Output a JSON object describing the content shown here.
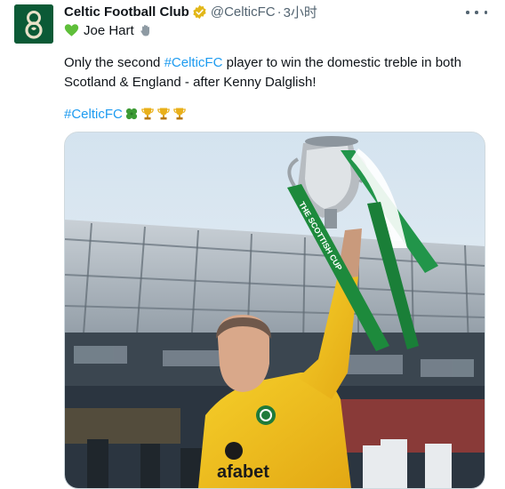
{
  "tweet": {
    "author_name": "Celtic Football Club",
    "handle": "@CelticFC",
    "separator": "·",
    "time": "3小时",
    "subline_text": "Joe Hart",
    "body_hashtag": "#CelticFC",
    "body_line1_rest": " player to win the domestic treble in both",
    "body_prefix": "Only the second ",
    "body_line2": "Scotland & England - after Kenny Dalglish!",
    "tag_line_hashtag": "#CelticFC"
  },
  "media": {
    "sponsor_text": "afabet",
    "ribbon_text": "THE SCOTTISH CUP"
  },
  "icons": {
    "verified": "verified-badge-icon",
    "more": "more-icon",
    "heart": "green-heart-emoji",
    "hand": "waving-hand-emoji",
    "clover": "four-leaf-clover-emoji",
    "trophy": "trophy-emoji"
  },
  "colors": {
    "link": "#1d9bf0",
    "celtic_green": "#0b5a36",
    "verified_gold": "#e2b719",
    "kit_yellow": "#f2c21b"
  }
}
